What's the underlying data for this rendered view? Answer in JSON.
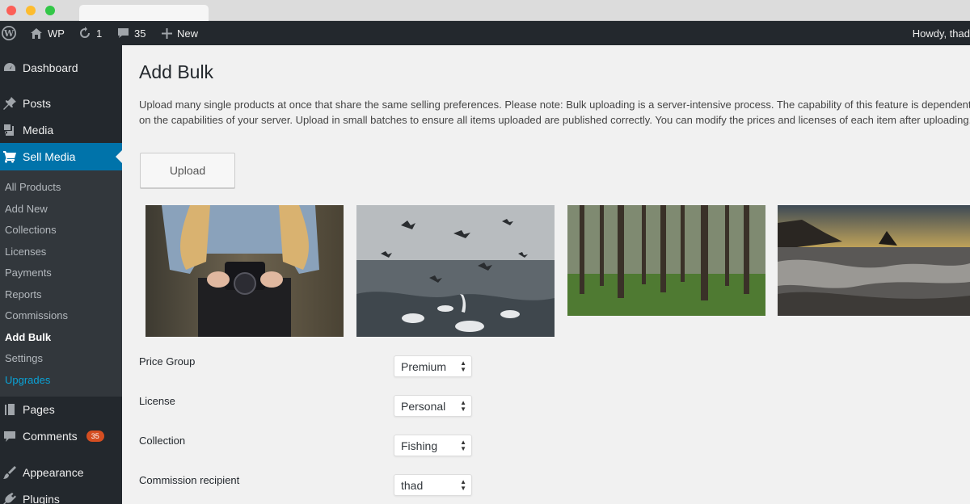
{
  "admin_bar": {
    "site_label": "WP",
    "updates_count": "1",
    "comments_count": "35",
    "new_label": "New",
    "howdy": "Howdy, thad"
  },
  "sidebar": {
    "dashboard": "Dashboard",
    "posts": "Posts",
    "media": "Media",
    "sell_media": "Sell Media",
    "submenu": [
      "All Products",
      "Add New",
      "Collections",
      "Licenses",
      "Payments",
      "Reports",
      "Commissions",
      "Add Bulk",
      "Settings",
      "Upgrades"
    ],
    "pages": "Pages",
    "comments": "Comments",
    "comments_badge": "35",
    "appearance": "Appearance",
    "plugins": "Plugins"
  },
  "main": {
    "title": "Add Bulk",
    "description": "Upload many single products at once that share the same selling preferences. Please note: Bulk uploading is a server-intensive process. The capability of this feature is dependent on the capabilities of your server. Upload in small batches to ensure all items uploaded are published correctly. You can modify the prices and licenses of each item after uploading.",
    "upload_label": "Upload",
    "fields": [
      {
        "label": "Price Group",
        "value": "Premium"
      },
      {
        "label": "License",
        "value": "Personal"
      },
      {
        "label": "Collection",
        "value": "Fishing"
      },
      {
        "label": "Commission recipient",
        "value": "thad"
      }
    ]
  },
  "colors": {
    "admin_bar": "#23282d",
    "sidebar": "#23282d",
    "submenu": "#32373c",
    "accent": "#0073aa",
    "badge": "#d54e21",
    "upgrades_link": "#0aa2d6"
  }
}
